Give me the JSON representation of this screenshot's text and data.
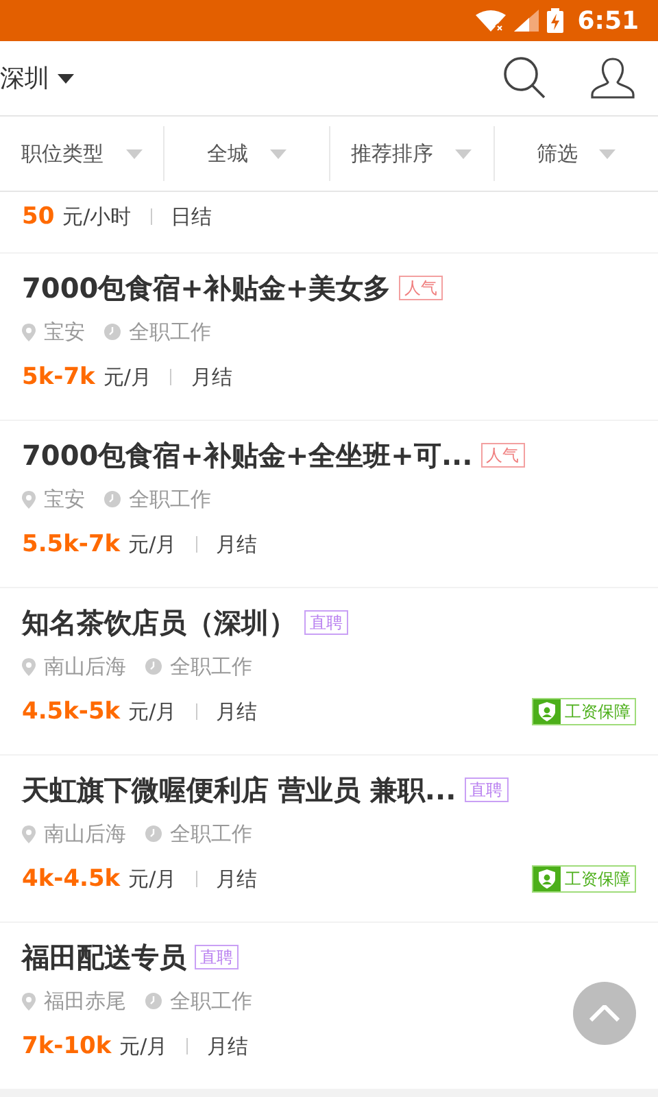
{
  "status_bar": {
    "time": "6:51"
  },
  "header": {
    "city": "深圳"
  },
  "filters": [
    {
      "label": "职位类型"
    },
    {
      "label": "全城"
    },
    {
      "label": "推荐排序"
    },
    {
      "label": "筛选"
    }
  ],
  "partial_job": {
    "pay": "50",
    "unit": "元/小时",
    "settlement": "日结"
  },
  "jobs": [
    {
      "title": "7000包食宿+补贴金+美女多",
      "tag": {
        "kind": "hot",
        "text": "人气"
      },
      "location": "宝安",
      "type": "全职工作",
      "pay": "5k-7k",
      "unit": "元/月",
      "settlement": "月结"
    },
    {
      "title": "7000包食宿+补贴金+全坐班+可...",
      "tag": {
        "kind": "hot",
        "text": "人气"
      },
      "location": "宝安",
      "type": "全职工作",
      "pay": "5.5k-7k",
      "unit": "元/月",
      "settlement": "月结"
    },
    {
      "title": "知名茶饮店员（深圳）",
      "tag": {
        "kind": "direct",
        "text": "直聘"
      },
      "location": "南山后海",
      "type": "全职工作",
      "pay": "4.5k-5k",
      "unit": "元/月",
      "settlement": "月结",
      "badge": "工资保障"
    },
    {
      "title": "天虹旗下微喔便利店 营业员 兼职...",
      "tag": {
        "kind": "direct",
        "text": "直聘"
      },
      "location": "南山后海",
      "type": "全职工作",
      "pay": "4k-4.5k",
      "unit": "元/月",
      "settlement": "月结",
      "badge": "工资保障"
    },
    {
      "title": "福田配送专员",
      "tag": {
        "kind": "direct",
        "text": "直聘"
      },
      "location": "福田赤尾",
      "type": "全职工作",
      "pay": "7k-10k",
      "unit": "元/月",
      "settlement": "月结"
    }
  ]
}
